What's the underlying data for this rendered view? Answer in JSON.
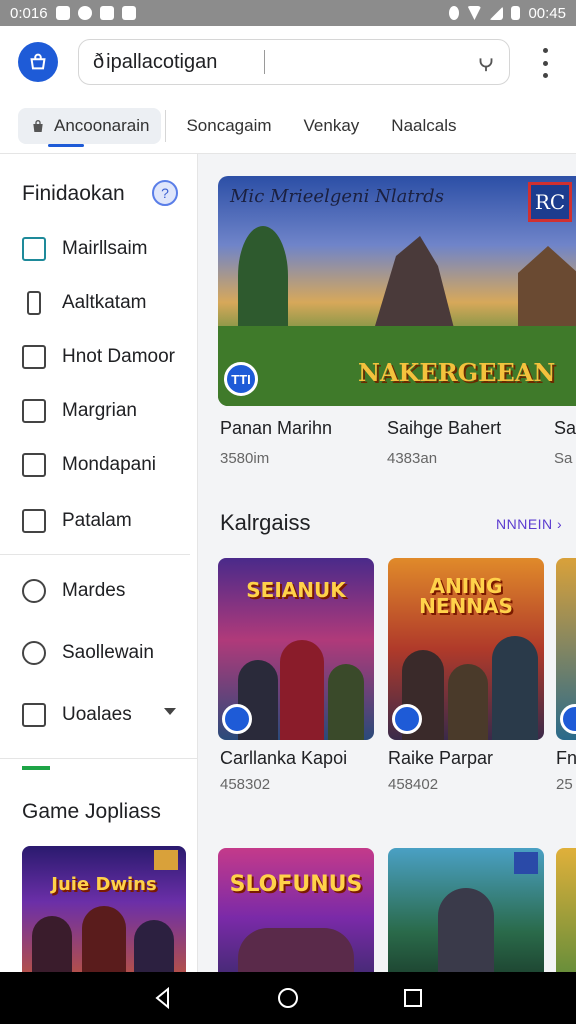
{
  "status_bar": {
    "time": "0:016",
    "time_right": "00:45"
  },
  "header": {
    "search_value": "ipallacotigan",
    "search_prefix": "ð",
    "tabs": [
      {
        "label": "Ancoonarain"
      },
      {
        "label": "Soncagaim"
      },
      {
        "label": "Venkay"
      },
      {
        "label": "Naalcals"
      }
    ]
  },
  "sidebar": {
    "section_title": "Finidaokan",
    "help_glyph": "?",
    "items": [
      {
        "label": "Mairllsaim"
      },
      {
        "label": "Aaltkatam"
      },
      {
        "label": "Hnot Damoor"
      },
      {
        "label": "Margrian"
      },
      {
        "label": "Mondapani"
      },
      {
        "label": "Patalam"
      }
    ],
    "items2": [
      {
        "label": "Mardes"
      },
      {
        "label": "Saollewain"
      },
      {
        "label": "Uoalaes"
      }
    ],
    "game_section_title": "Game Jopliass",
    "game_thumb_title": "Juie Dwins"
  },
  "featured": {
    "title": "Mic Mrieelgeni Nlatrds",
    "logo_text": "RC",
    "banner": "NAKERGEEAN",
    "badge": "TTI",
    "apps": [
      {
        "name": "Panan Marihn",
        "size": "3580im"
      },
      {
        "name": "Saihge Bahert",
        "size": "4383an"
      },
      {
        "name": "Sa",
        "size": "Sa"
      }
    ]
  },
  "section": {
    "title": "Kalrgaiss",
    "see_more": "NNNEIN ›",
    "apps": [
      {
        "title_art": "SEIANUK",
        "name": "Carllanka Kapoi",
        "size": "458302"
      },
      {
        "title_art": "ANING NENNAS",
        "name": "Raike Parpar",
        "size": "458402"
      },
      {
        "title_art": "",
        "name": "Fn",
        "size": "25"
      }
    ]
  },
  "bottom_row": [
    {
      "title_art": "SLOFUNUS"
    },
    {
      "title_art": ""
    },
    {
      "title_art": ""
    }
  ],
  "colors": {
    "accent": "#1e5bd7",
    "link": "#5b3bd0",
    "green": "#1ea446"
  }
}
